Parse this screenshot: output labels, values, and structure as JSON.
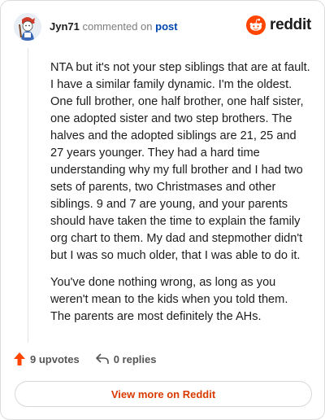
{
  "header": {
    "username": "Jyn71",
    "commented_on": "commented on",
    "post_link": "post",
    "brand": "reddit",
    "avatar_icon": "avatar-icon",
    "logo_icon": "reddit-snoo-icon"
  },
  "comment": {
    "paragraphs": [
      "NTA but it's not your step siblings that are at fault. I have a similar family dynamic. I'm the oldest. One full brother, one half brother, one half sister, one adopted sister and two step brothers. The halves and the adopted siblings are 21, 25 and 27 years younger. They had a hard time understanding why my full brother and I had two sets of parents, two Christmases and other siblings. 9 and 7 are young, and your parents should have taken the time to explain the family org chart to them. My dad and stepmother didn't but I was so much older, that I was able to do it.",
      "You've done nothing wrong, as long as you weren't mean to the kids when you told them. The parents are most definitely the AHs."
    ]
  },
  "actions": {
    "upvotes": "9 upvotes",
    "replies": "0 replies",
    "upvote_icon": "upvote-arrow-icon",
    "reply_icon": "reply-arrow-icon"
  },
  "footer": {
    "view_more": "View more on Reddit"
  },
  "colors": {
    "brand_orange": "#ff4500",
    "link_blue": "#0045ac",
    "cta_orange": "#d93a00"
  }
}
